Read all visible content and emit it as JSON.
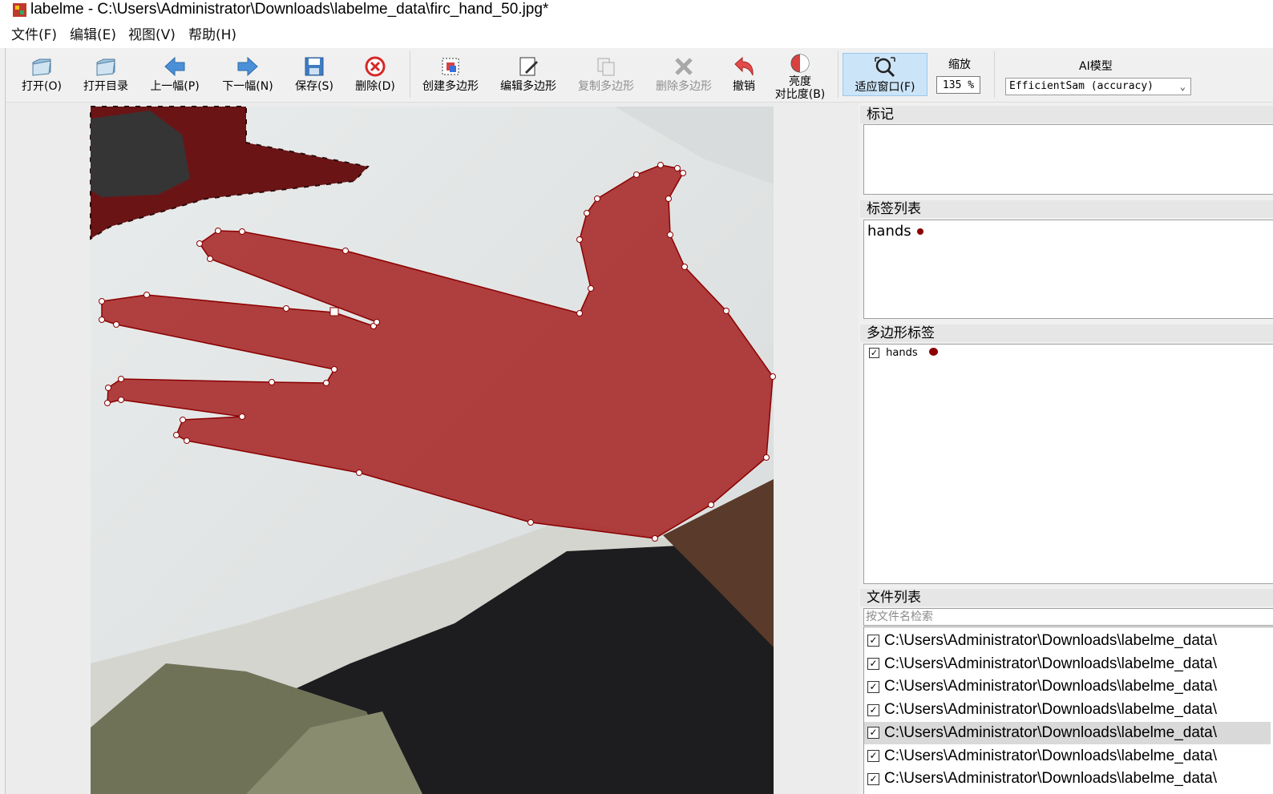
{
  "window": {
    "title": "labelme - C:\\Users\\Administrator\\Downloads\\labelme_data\\firc_hand_50.jpg*"
  },
  "menu": {
    "items": [
      "文件(F)",
      "编辑(E)",
      "视图(V)",
      "帮助(H)"
    ]
  },
  "toolbar": {
    "open": "打开(O)",
    "open_dir": "打开目录",
    "prev": "上一幅(P)",
    "next": "下一幅(N)",
    "save": "保存(S)",
    "delete": "删除(D)",
    "create_polygon": "创建多边形",
    "edit_polygon": "编辑多边形",
    "copy_polygon": "复制多边形",
    "delete_polygon": "删除多边形",
    "undo": "撤销",
    "brightness_line1": "亮度",
    "brightness_line2": "对比度(B)",
    "fit_window": "适应窗口(F)",
    "zoom_label": "缩放",
    "zoom_value": "135 %",
    "ai_model_label": "AI模型",
    "ai_model_value": "EfficientSam (accuracy)"
  },
  "docks": {
    "flags_title": "标记",
    "label_list_title": "标签列表",
    "label_list": [
      {
        "name": "hands",
        "color": "#8b0000"
      }
    ],
    "polygon_labels_title": "多边形标签",
    "polygon_labels": [
      {
        "name": "hands",
        "checked": true,
        "color": "#8b0000"
      }
    ],
    "file_list_title": "文件列表",
    "file_search_placeholder": "按文件名检索",
    "files": [
      {
        "path": "C:\\Users\\Administrator\\Downloads\\labelme_data\\",
        "checked": true
      },
      {
        "path": "C:\\Users\\Administrator\\Downloads\\labelme_data\\",
        "checked": true
      },
      {
        "path": "C:\\Users\\Administrator\\Downloads\\labelme_data\\",
        "checked": true
      },
      {
        "path": "C:\\Users\\Administrator\\Downloads\\labelme_data\\",
        "checked": true
      },
      {
        "path": "C:\\Users\\Administrator\\Downloads\\labelme_data\\",
        "checked": true,
        "selected": true
      },
      {
        "path": "C:\\Users\\Administrator\\Downloads\\labelme_data\\",
        "checked": true
      },
      {
        "path": "C:\\Users\\Administrator\\Downloads\\labelme_data\\",
        "checked": true
      }
    ]
  },
  "annotation": {
    "label": "hands",
    "fill_color": "#a01010",
    "line_color": "#8b0000"
  }
}
